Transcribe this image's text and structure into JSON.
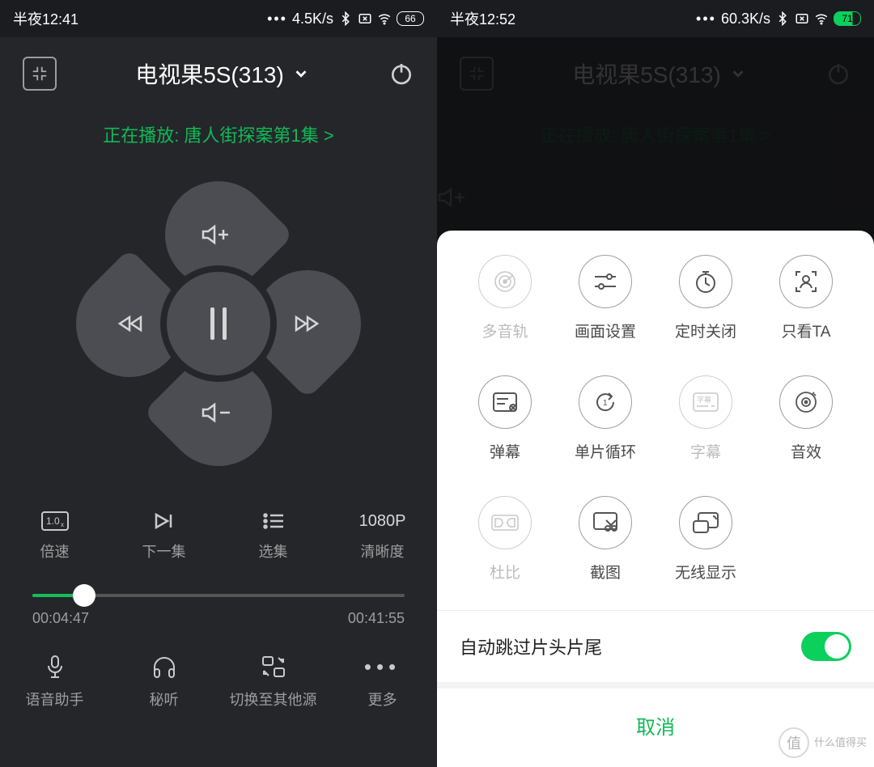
{
  "left": {
    "status": {
      "time_label": "半夜12:41",
      "net_speed": "4.5K/s",
      "battery": "66"
    },
    "header": {
      "title": "电视果5S(313)"
    },
    "now_playing": "正在播放: 唐人街探案第1集 >",
    "controls": {
      "speed": "倍速",
      "next": "下一集",
      "episodes": "选集",
      "quality_value": "1080P",
      "quality": "清晰度"
    },
    "speed_badge": "1.0",
    "progress": {
      "current": "00:04:47",
      "total": "00:41:55",
      "percent": 14
    },
    "bottom": {
      "voice": "语音助手",
      "listen": "秘听",
      "switch": "切换至其他源",
      "more": "更多"
    }
  },
  "right": {
    "status": {
      "time_label": "半夜12:52",
      "net_speed": "60.3K/s",
      "battery": "71"
    },
    "header": {
      "title": "电视果5S(313)"
    },
    "now_playing": "正在播放: 唐人街探案第1集 >",
    "grid": {
      "multi_audio": "多音轨",
      "picture": "画面设置",
      "timer": "定时关闭",
      "watch_ta": "只看TA",
      "danmu": "弹幕",
      "loop": "单片循环",
      "subtitle": "字幕",
      "subtitle_badge": "字幕",
      "sound": "音效",
      "dolby": "杜比",
      "screenshot": "截图",
      "wireless": "无线显示"
    },
    "toggle_label": "自动跳过片头片尾",
    "cancel": "取消"
  },
  "watermark": "什么值得买"
}
